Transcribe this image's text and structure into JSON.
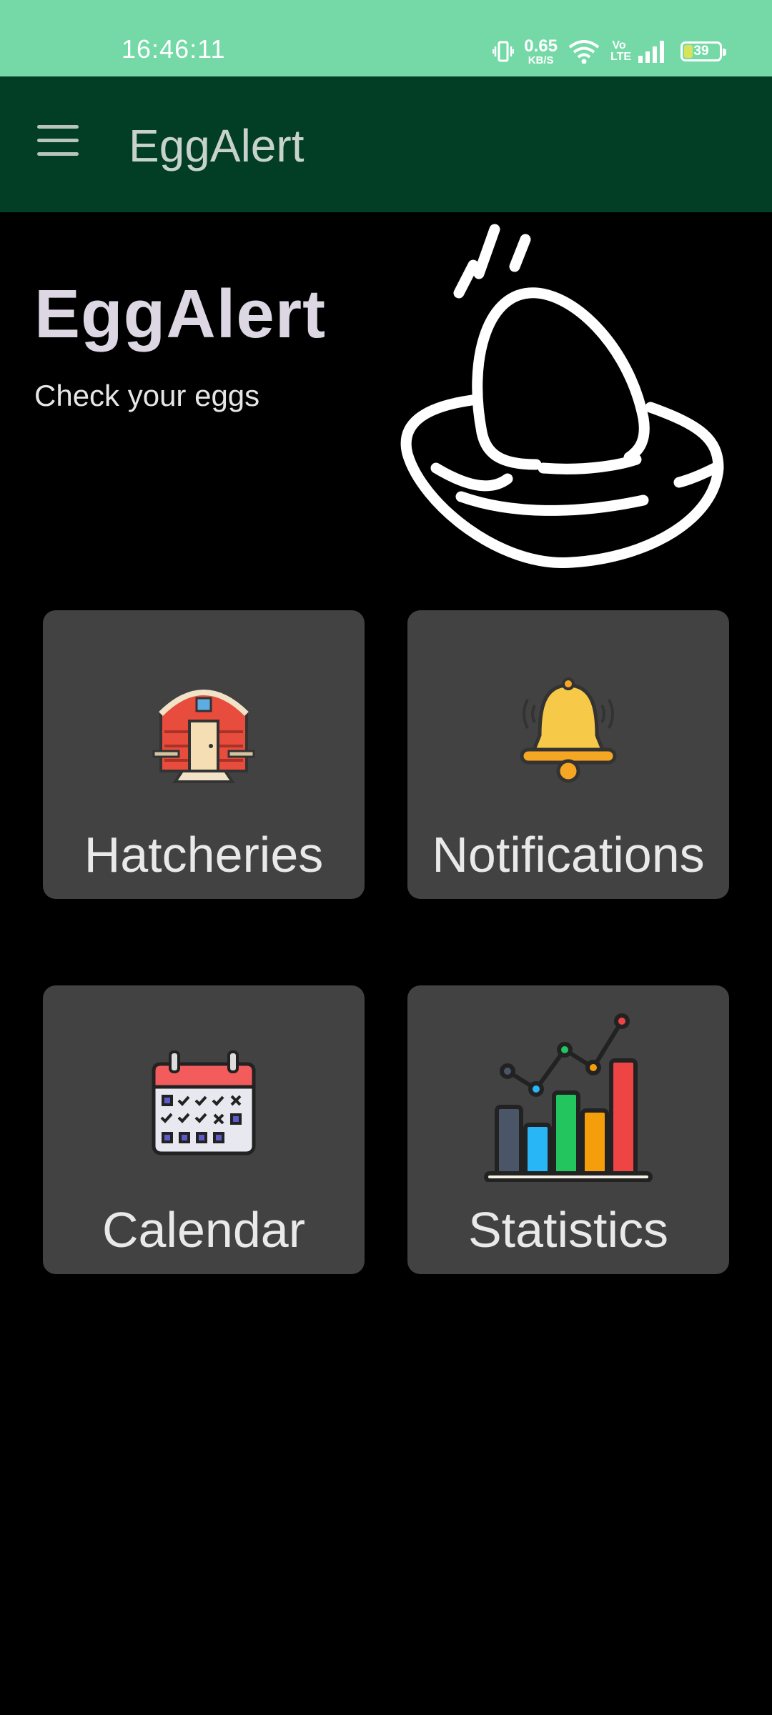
{
  "status_bar": {
    "time": "16:46:11",
    "net_speed_value": "0.65",
    "net_speed_unit": "KB/S",
    "network_label": "Vo LTE",
    "battery_level": "39",
    "icons": [
      "vibrate-icon",
      "wifi-icon",
      "signal-icon",
      "battery-icon"
    ]
  },
  "app_bar": {
    "title": "EggAlert",
    "menu_icon": "hamburger-menu-icon"
  },
  "hero": {
    "title": "EggAlert",
    "subtitle": "Check your eggs",
    "illustration": "egg-in-nest-icon"
  },
  "cards": [
    {
      "label": "Hatcheries",
      "icon": "barn-icon"
    },
    {
      "label": "Notifications",
      "icon": "bell-icon"
    },
    {
      "label": "Calendar",
      "icon": "calendar-icon"
    },
    {
      "label": "Statistics",
      "icon": "bar-chart-icon"
    }
  ],
  "colors": {
    "status_bar": "#74d9a7",
    "app_bar": "#023e25",
    "background": "#000000",
    "card": "#424242"
  }
}
